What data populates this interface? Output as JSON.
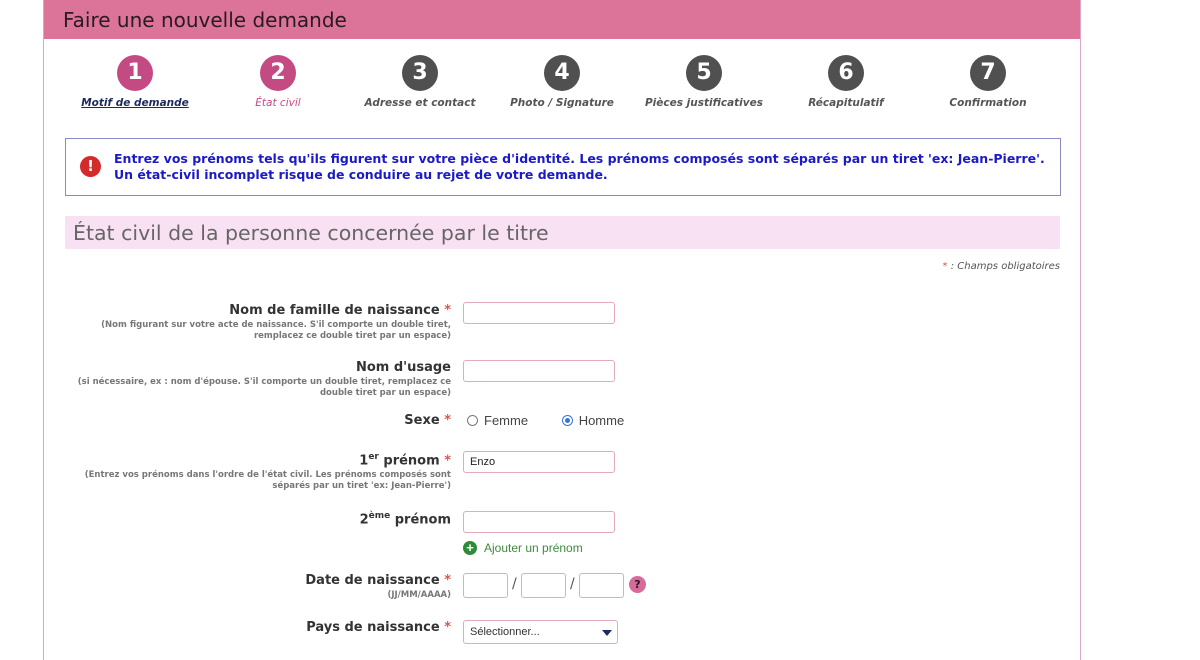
{
  "header": {
    "title": "Faire une nouvelle demande"
  },
  "steps": [
    {
      "number": "1",
      "label": "Motif de demande",
      "state": "done"
    },
    {
      "number": "2",
      "label": "État civil",
      "state": "active"
    },
    {
      "number": "3",
      "label": "Adresse et contact",
      "state": "todo"
    },
    {
      "number": "4",
      "label": "Photo / Signature",
      "state": "todo"
    },
    {
      "number": "5",
      "label": "Pièces justificatives",
      "state": "todo"
    },
    {
      "number": "6",
      "label": "Récapitulatif",
      "state": "todo"
    },
    {
      "number": "7",
      "label": "Confirmation",
      "state": "todo"
    }
  ],
  "alert": {
    "icon": "exclamation-icon",
    "glyph": "!",
    "text": "Entrez vos prénoms tels qu'ils figurent sur votre pièce d'identité. Les prénoms composés sont séparés par un tiret 'ex: Jean-Pierre'. Un état-civil incomplet risque de conduire au rejet de votre demande."
  },
  "section": {
    "title": "État civil de la personne concernée par le titre",
    "required_star": "*",
    "required_note": " : Champs obligatoires"
  },
  "form": {
    "required_mark": "*",
    "nom_naissance": {
      "label": "Nom de famille de naissance",
      "help": "(Nom figurant sur votre acte de naissance. S'il comporte un double tiret, remplacez ce double tiret par un espace)",
      "value": ""
    },
    "nom_usage": {
      "label": "Nom d'usage",
      "help": "(si nécessaire, ex : nom d'épouse. S'il comporte un double tiret, remplacez ce double tiret par un espace)",
      "value": ""
    },
    "sexe": {
      "label": "Sexe",
      "options": [
        "Femme",
        "Homme"
      ],
      "selected": "Homme"
    },
    "prenom1": {
      "label_num": "1",
      "label_sup": "er",
      "label_rest": " prénom",
      "help": "(Entrez vos prénoms dans l'ordre de l'état civil. Les prénoms composés sont séparés par un tiret 'ex: Jean-Pierre')",
      "value": "Enzo"
    },
    "prenom2": {
      "label_num": "2",
      "label_sup": "ème",
      "label_rest": " prénom",
      "value": ""
    },
    "add_prenom": {
      "icon": "plus",
      "label": "Ajouter un prénom"
    },
    "date_naissance": {
      "label": "Date de naissance",
      "format": "(JJ/MM/AAAA)",
      "separator": "/",
      "day": "",
      "month": "",
      "year": "",
      "help_glyph": "?"
    },
    "pays_naissance": {
      "label": "Pays de naissance",
      "selected": "Sélectionner..."
    }
  }
}
